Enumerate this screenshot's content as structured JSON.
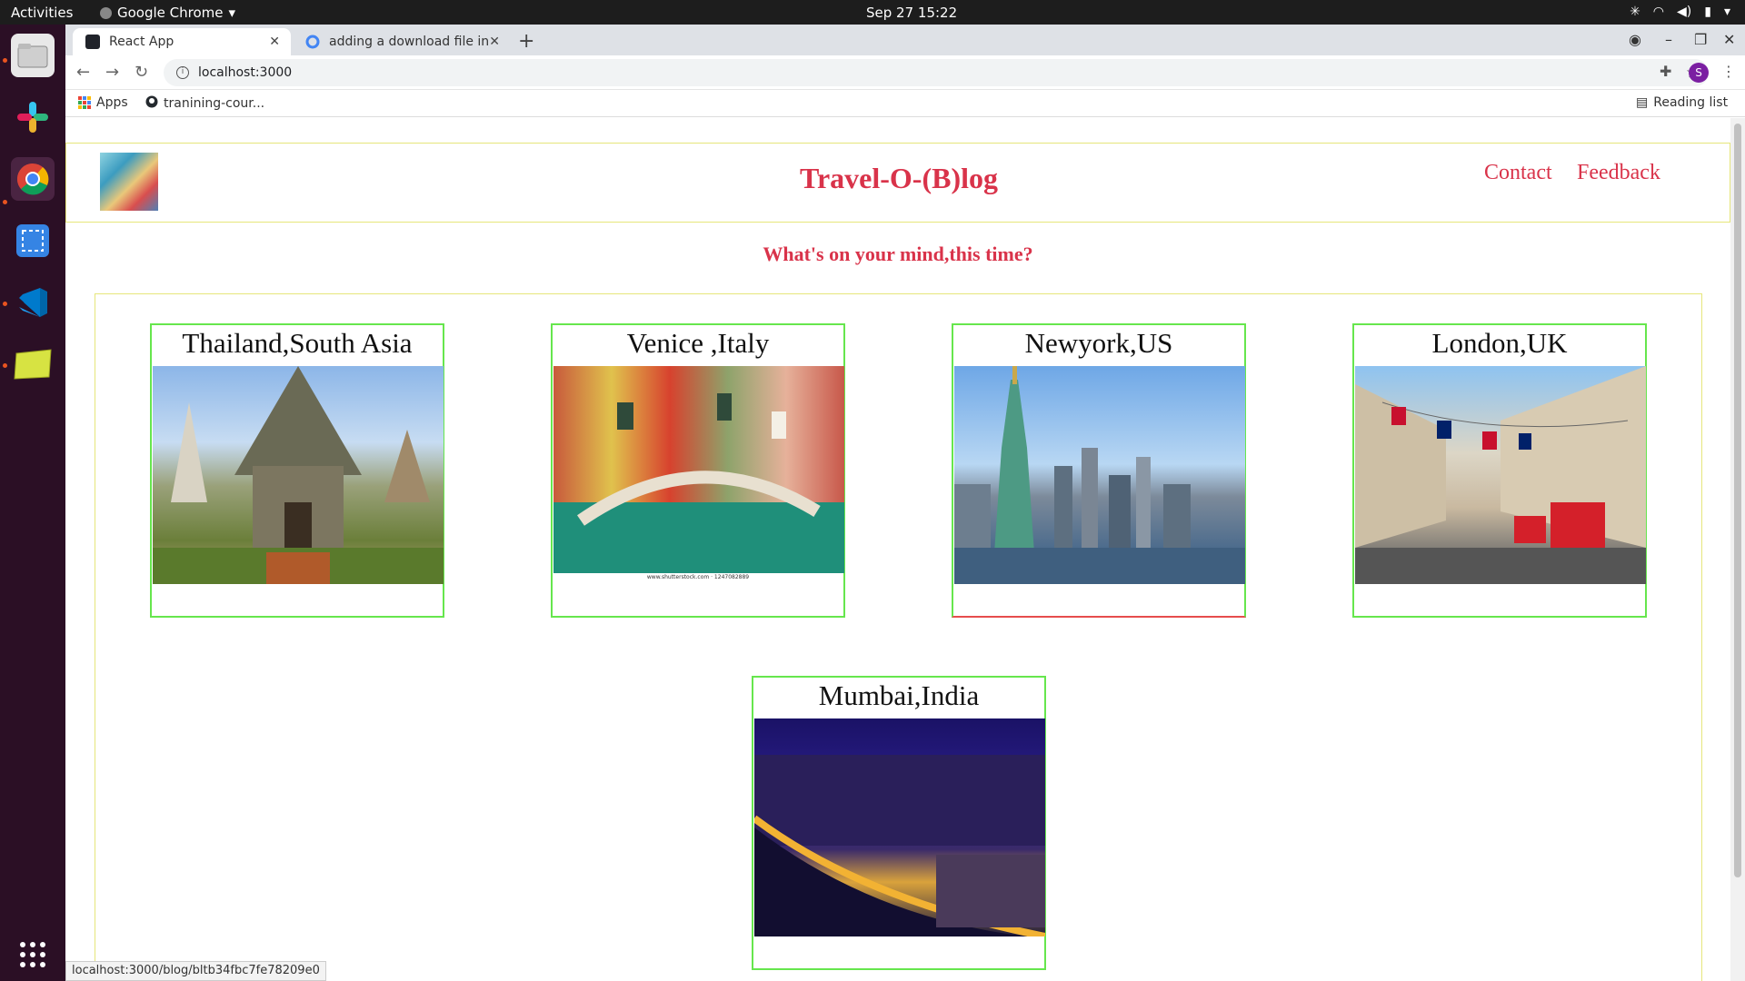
{
  "system": {
    "activities": "Activities",
    "app_menu": "Google Chrome",
    "clock": "Sep 27  15:22"
  },
  "dock": {
    "items": [
      "files-icon",
      "slack-icon",
      "chrome-icon",
      "screenshot-icon",
      "vscode-icon",
      "notes-icon",
      "app-grid-icon"
    ]
  },
  "browser": {
    "tabs": [
      {
        "title": "React App",
        "active": true
      },
      {
        "title": "adding a download file in",
        "active": false
      }
    ],
    "url": "localhost:3000",
    "bookmarks": {
      "apps": "Apps",
      "github": "tranining-cour...",
      "reading_list": "Reading list"
    },
    "profile_initial": "S",
    "status_url": "localhost:3000/blog/bltb34fbc7fe78209e0"
  },
  "site": {
    "title": "Travel-O-(B)log",
    "nav": [
      "Contact",
      "Feedback"
    ],
    "tagline": "What's on your mind,this time?",
    "cards": [
      {
        "title": "Thailand,South Asia"
      },
      {
        "title": "Venice ,Italy",
        "caption": "www.shutterstock.com · 1247082889"
      },
      {
        "title": "Newyork,US"
      },
      {
        "title": "London,UK"
      },
      {
        "title": "Mumbai,India"
      }
    ]
  },
  "colors": {
    "accent": "#d9334a",
    "card_border": "#66e64d",
    "container_border": "#e6e67a"
  }
}
